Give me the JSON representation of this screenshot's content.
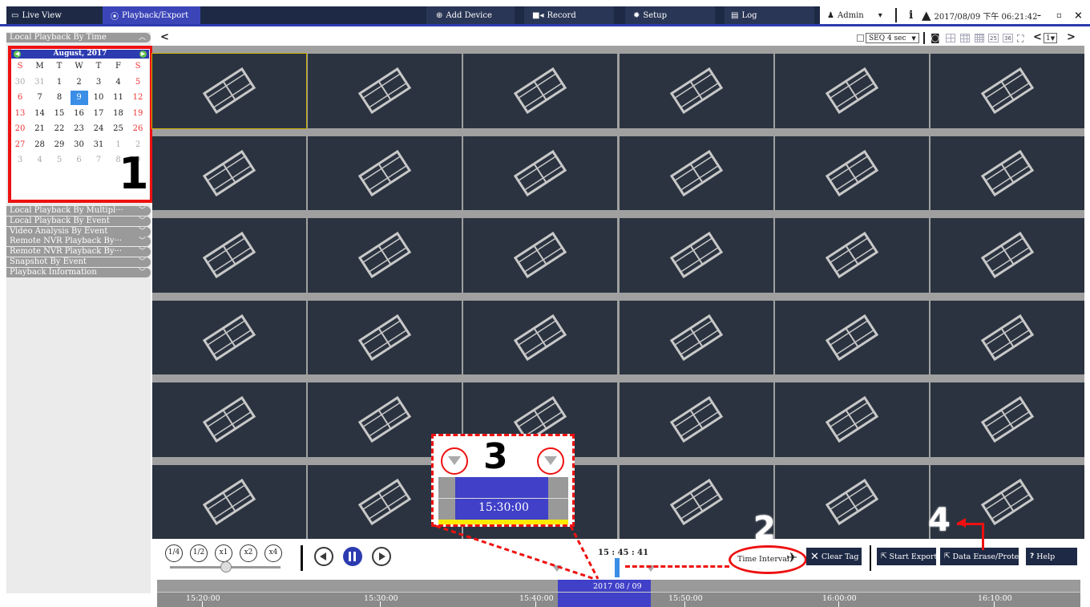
{
  "topbar": {
    "live_view": "Live View",
    "playback_export": "Playback/Export",
    "add_device": "Add Device",
    "record": "Record",
    "setup": "Setup",
    "log": "Log",
    "user": "Admin",
    "user_dropdown": "▾",
    "info_icon": "i",
    "datetime": "2017/08/09 下午 06:21:42",
    "minimize": "–",
    "restore": "▫",
    "close": "×"
  },
  "sidebar": {
    "section_time": "Local Playback By Time",
    "calendar": {
      "month_year": "August, 2017",
      "weekdays": [
        "S",
        "M",
        "T",
        "W",
        "T",
        "F",
        "S"
      ],
      "weeks": [
        [
          "30",
          "31",
          "1",
          "2",
          "3",
          "4",
          "5"
        ],
        [
          "6",
          "7",
          "8",
          "9",
          "10",
          "11",
          "12"
        ],
        [
          "13",
          "14",
          "15",
          "16",
          "17",
          "18",
          "19"
        ],
        [
          "20",
          "21",
          "22",
          "23",
          "24",
          "25",
          "26"
        ],
        [
          "27",
          "28",
          "29",
          "30",
          "31",
          "1",
          "2"
        ],
        [
          "3",
          "4",
          "5",
          "6",
          "7",
          "8",
          "9"
        ]
      ],
      "selected_day": "9"
    },
    "annotation_1": "1",
    "sections": [
      "Local Playback By Multipl···",
      "Local Playback By Event",
      "Video Analysis By Event",
      "Remote NVR Playback By···",
      "Remote NVR Playback By···",
      "Snapshot By Event",
      "Playback Information"
    ]
  },
  "toolbar": {
    "collapse": "<",
    "seq": "SEQ 4 sec",
    "layout_25": "25",
    "layout_36": "36",
    "page": "1",
    "prev": "<",
    "next": ">"
  },
  "zoom_overlay": {
    "annotation_3": "3",
    "time": "15:30:00"
  },
  "controls": {
    "speeds": [
      "1/4",
      "1/2",
      "x1",
      "x2",
      "x4"
    ],
    "current_time": "15 : 45 : 41",
    "time_interval": "Time Interval",
    "clear_tag": "Clear Tag",
    "start_export": "Start Export",
    "data_erase": "Data Erase/Protect",
    "help": "Help",
    "annotation_2": "2",
    "annotation_4": "4",
    "date_label": "2017 08 / 09",
    "ticks": [
      "15:20:00",
      "15:30:00",
      "15:40:00",
      "15:50:00",
      "16:00:00",
      "16:10:00"
    ]
  },
  "colors": {
    "nav": "#1e2a45",
    "active_tab": "#3b45b8",
    "accent": "#2c3bb0",
    "highlight": "#e11111",
    "cell_bg": "#2b3340"
  }
}
